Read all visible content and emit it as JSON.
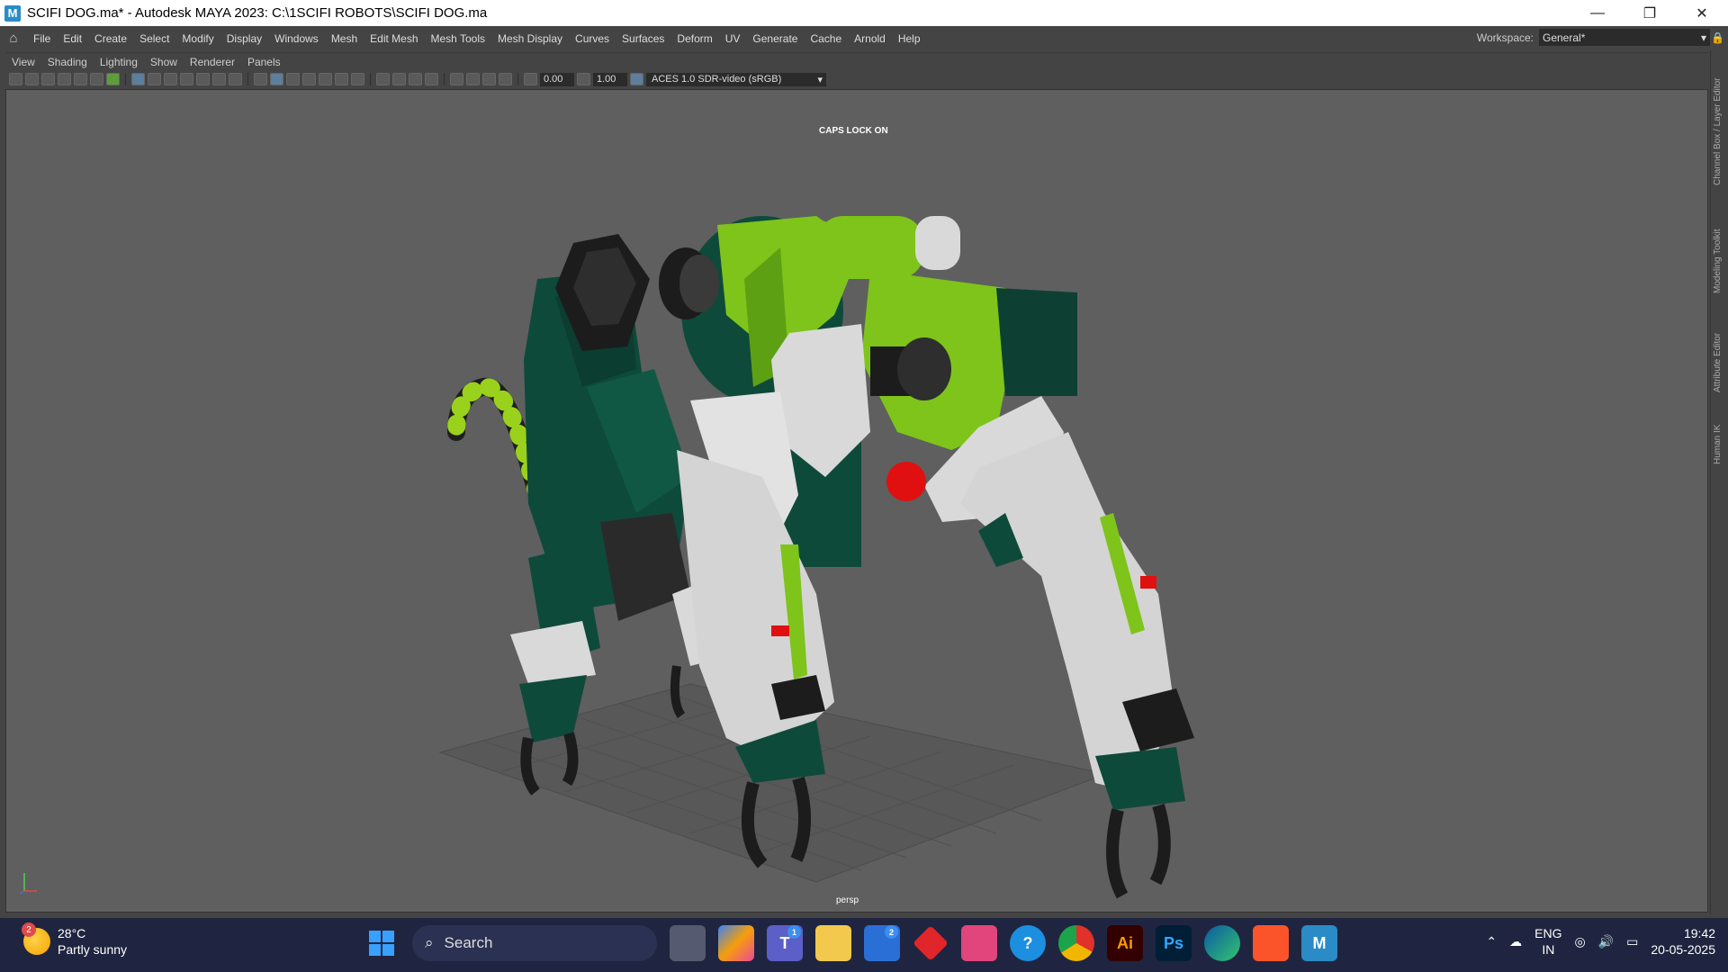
{
  "window": {
    "title": "SCIFI DOG.ma* - Autodesk MAYA 2023: C:\\1SCIFI ROBOTS\\SCIFI DOG.ma",
    "app_icon_letter": "M",
    "controls": {
      "minimize": "—",
      "restore": "❐",
      "close": "✕"
    }
  },
  "menubar": {
    "items": [
      "File",
      "Edit",
      "Create",
      "Select",
      "Modify",
      "Display",
      "Windows",
      "Mesh",
      "Edit Mesh",
      "Mesh Tools",
      "Mesh Display",
      "Curves",
      "Surfaces",
      "Deform",
      "UV",
      "Generate",
      "Cache",
      "Arnold",
      "Help"
    ],
    "workspace_label": "Workspace:",
    "workspace_value": "General*"
  },
  "panel_menu": {
    "items": [
      "View",
      "Shading",
      "Lighting",
      "Show",
      "Renderer",
      "Panels"
    ]
  },
  "panel_toolbar": {
    "exposure": "0.00",
    "gamma": "1.00",
    "color_space": "ACES 1.0 SDR-video (sRGB)"
  },
  "viewport": {
    "caps_lock_text": "CAPS LOCK ON",
    "camera_name": "persp",
    "colors": {
      "background": "#5f5f5f",
      "dark_green": "#0e4a3a",
      "lime_green": "#7ec41a",
      "white_armor": "#d9d9d9",
      "black_parts": "#1c1c1c",
      "red_light": "#e01010"
    }
  },
  "side_tabs": [
    "Channel Box / Layer Editor",
    "Modeling Toolkit",
    "Attribute Editor",
    "Human IK"
  ],
  "taskbar": {
    "weather": {
      "temp": "28°C",
      "condition": "Partly sunny",
      "badge": "2"
    },
    "search_placeholder": "Search",
    "apps": [
      {
        "name": "task-view",
        "label": ""
      },
      {
        "name": "copilot",
        "label": ""
      },
      {
        "name": "teams",
        "label": "T",
        "badge": "1"
      },
      {
        "name": "file-explorer",
        "label": ""
      },
      {
        "name": "microsoft-store",
        "label": "",
        "badge": "2"
      },
      {
        "name": "app-red",
        "label": ""
      },
      {
        "name": "forza",
        "label": ""
      },
      {
        "name": "get-help",
        "label": "?"
      },
      {
        "name": "chrome",
        "label": ""
      },
      {
        "name": "illustrator",
        "label": "Ai"
      },
      {
        "name": "photoshop",
        "label": "Ps"
      },
      {
        "name": "edge",
        "label": ""
      },
      {
        "name": "brave",
        "label": ""
      },
      {
        "name": "maya",
        "label": "M"
      }
    ],
    "language": {
      "line1": "ENG",
      "line2": "IN"
    },
    "clock": {
      "time": "19:42",
      "date": "20-05-2025"
    }
  }
}
